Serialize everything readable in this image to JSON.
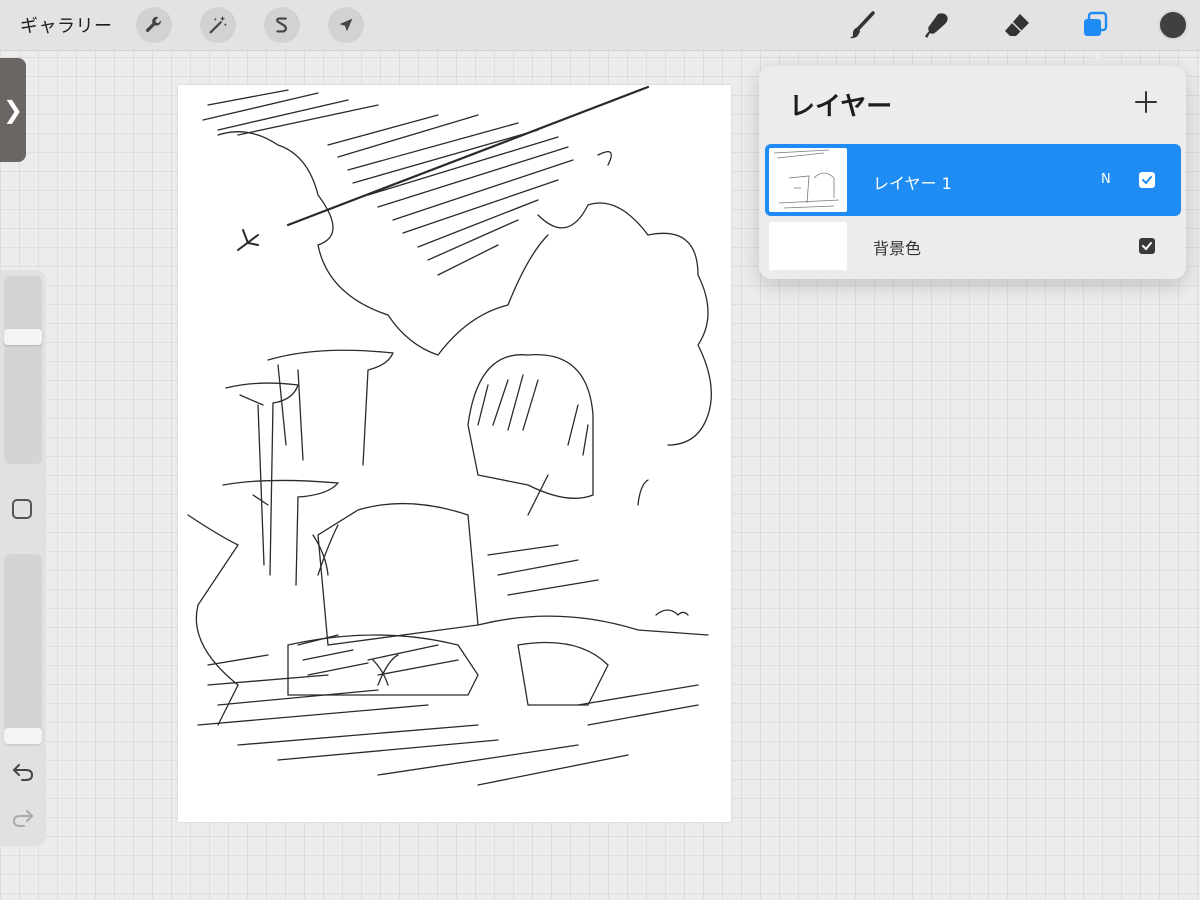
{
  "topbar": {
    "gallery_label": "ギャラリー",
    "tools_left": [
      {
        "name": "actions",
        "icon": "wrench-icon"
      },
      {
        "name": "adjustments",
        "icon": "magic-wand-icon"
      },
      {
        "name": "selection",
        "icon": "selection-s-icon"
      },
      {
        "name": "transform",
        "icon": "arrow-cursor-icon"
      }
    ],
    "tools_right": [
      {
        "name": "brush",
        "icon": "brush-icon"
      },
      {
        "name": "smudge",
        "icon": "smudge-icon"
      },
      {
        "name": "eraser",
        "icon": "eraser-icon"
      },
      {
        "name": "layers",
        "icon": "layers-icon",
        "active": true
      }
    ],
    "current_color": "#404042"
  },
  "side_panel": {
    "toggle_glyph": "❯",
    "brush_size_level": 0.69,
    "opacity_level": 0.0
  },
  "layers_panel": {
    "title": "レイヤー",
    "add_glyph": "+",
    "layers": [
      {
        "name": "レイヤー 1",
        "blend_mode": "N",
        "visible": true,
        "selected": true
      },
      {
        "name": "背景色",
        "visible": true,
        "selected": false
      }
    ]
  },
  "colors": {
    "accent": "#1e8cf2",
    "background": "#ececee"
  }
}
